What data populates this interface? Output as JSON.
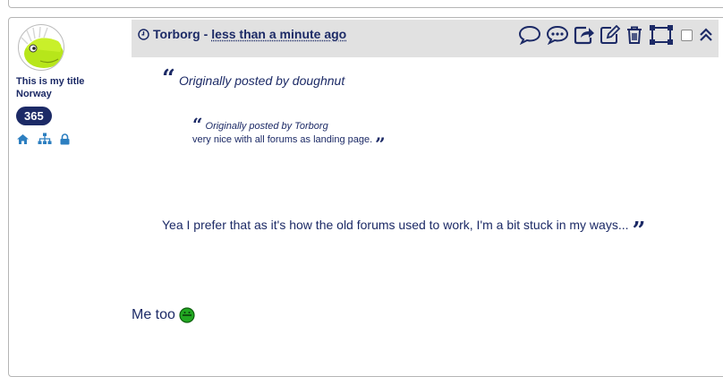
{
  "author": {
    "title": "This is my title",
    "location": "Norway",
    "post_count": "365",
    "icons": [
      "home-icon",
      "sitemap-icon",
      "lock-icon"
    ]
  },
  "post": {
    "username": "Torborg",
    "separator": "-",
    "time_ago": "less than a minute ago",
    "actions": [
      "comment-icon",
      "comments-icon",
      "share-icon",
      "edit-icon",
      "trash-icon",
      "split-icon",
      "checkbox",
      "collapse-icon"
    ],
    "outer_quote": {
      "header": "Originally posted by doughnut",
      "body": "Yea I prefer that as it's how the old forums used to work, I'm a bit stuck in my ways..."
    },
    "inner_quote": {
      "header": "Originally posted by Torborg",
      "body": "very nice with all forums as landing page."
    },
    "reply": "Me too"
  },
  "colors": {
    "text": "#1c2a66",
    "header_bg": "#e1e1e1",
    "avatar_green": "#b7e61a",
    "smiley_green": "#22a822"
  }
}
